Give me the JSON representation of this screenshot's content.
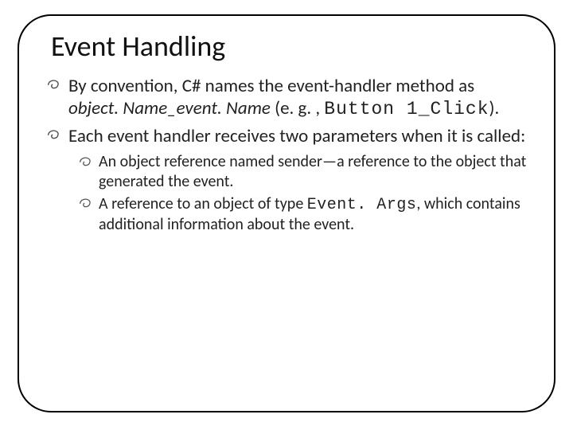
{
  "title": "Event Handling",
  "bullets": [
    {
      "pre": "By convention, C# names the event-handler method as ",
      "italic": "object. Name_event. Name",
      "mid": " (e. g. , ",
      "code": "Button 1_Click",
      "post": ")."
    },
    {
      "text": "Each event handler receives two parameters when it is called:",
      "sub": [
        {
          "text": "An object reference named sender—a reference to the object that generated the event."
        },
        {
          "pre": "A reference to an object of type ",
          "code": "Event. Args",
          "post": ", which contains additional information about the event."
        }
      ]
    }
  ]
}
